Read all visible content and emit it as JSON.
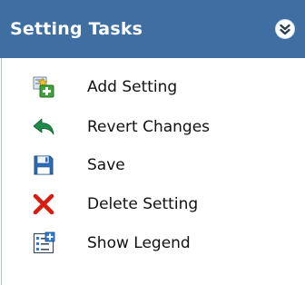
{
  "panel": {
    "title": "Setting Tasks",
    "collapse_icon": "chevron-double-up-icon",
    "header_color": "#3e6ea2"
  },
  "tasks": [
    {
      "label": "Add Setting",
      "icon": "add-setting-icon"
    },
    {
      "label": "Revert Changes",
      "icon": "revert-arrow-icon"
    },
    {
      "label": "Save",
      "icon": "floppy-disk-icon"
    },
    {
      "label": "Delete Setting",
      "icon": "delete-x-icon"
    },
    {
      "label": "Show Legend",
      "icon": "legend-icon"
    }
  ]
}
